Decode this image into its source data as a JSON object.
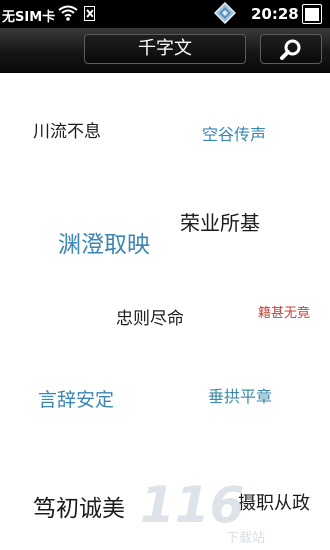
{
  "status_bar": {
    "carrier": "无SIM卡",
    "time": "20:28",
    "icons": [
      "wifi-icon",
      "no-sim-icon",
      "gem-icon",
      "battery-icon"
    ]
  },
  "title_bar": {
    "title": "千字文",
    "search_icon": "search-icon"
  },
  "phrases": [
    {
      "text": "川流不息",
      "color": "#1c1c1c"
    },
    {
      "text": "空谷传声",
      "color": "#3b86b3"
    },
    {
      "text": "渊澄取映",
      "color": "#3b86b3"
    },
    {
      "text": "荣业所基",
      "color": "#1c1c1c"
    },
    {
      "text": "忠则尽命",
      "color": "#1c1c1c"
    },
    {
      "text": "籍甚无竟",
      "color": "#c8443a"
    },
    {
      "text": "言辞安定",
      "color": "#3b86b3"
    },
    {
      "text": "垂拱平章",
      "color": "#3d8aa8"
    },
    {
      "text": "笃初诚美",
      "color": "#1c1c1c"
    },
    {
      "text": "摄职从政",
      "color": "#1c1c1c"
    }
  ],
  "watermark": {
    "text": "116",
    "sub": "下载站"
  }
}
